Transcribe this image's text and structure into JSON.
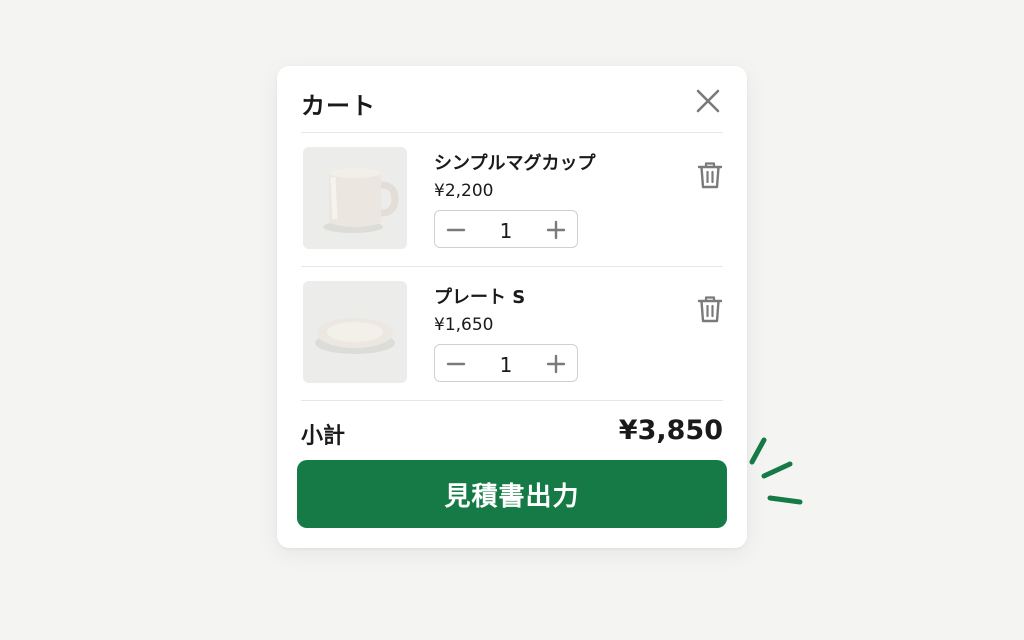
{
  "cart": {
    "title": "カート",
    "close_icon": "close-icon",
    "items": [
      {
        "name": "シンプルマグカップ",
        "price": "¥2,200",
        "quantity": "1",
        "image": "mug-image"
      },
      {
        "name": "プレート S",
        "price": "¥1,650",
        "quantity": "1",
        "image": "plate-image"
      }
    ],
    "subtotal_label": "小計",
    "subtotal_value": "¥3,850",
    "cta_label": "見積書出力"
  },
  "colors": {
    "accent": "#157a45",
    "background": "#f4f4f3",
    "icon_gray": "#7a7a7a"
  }
}
